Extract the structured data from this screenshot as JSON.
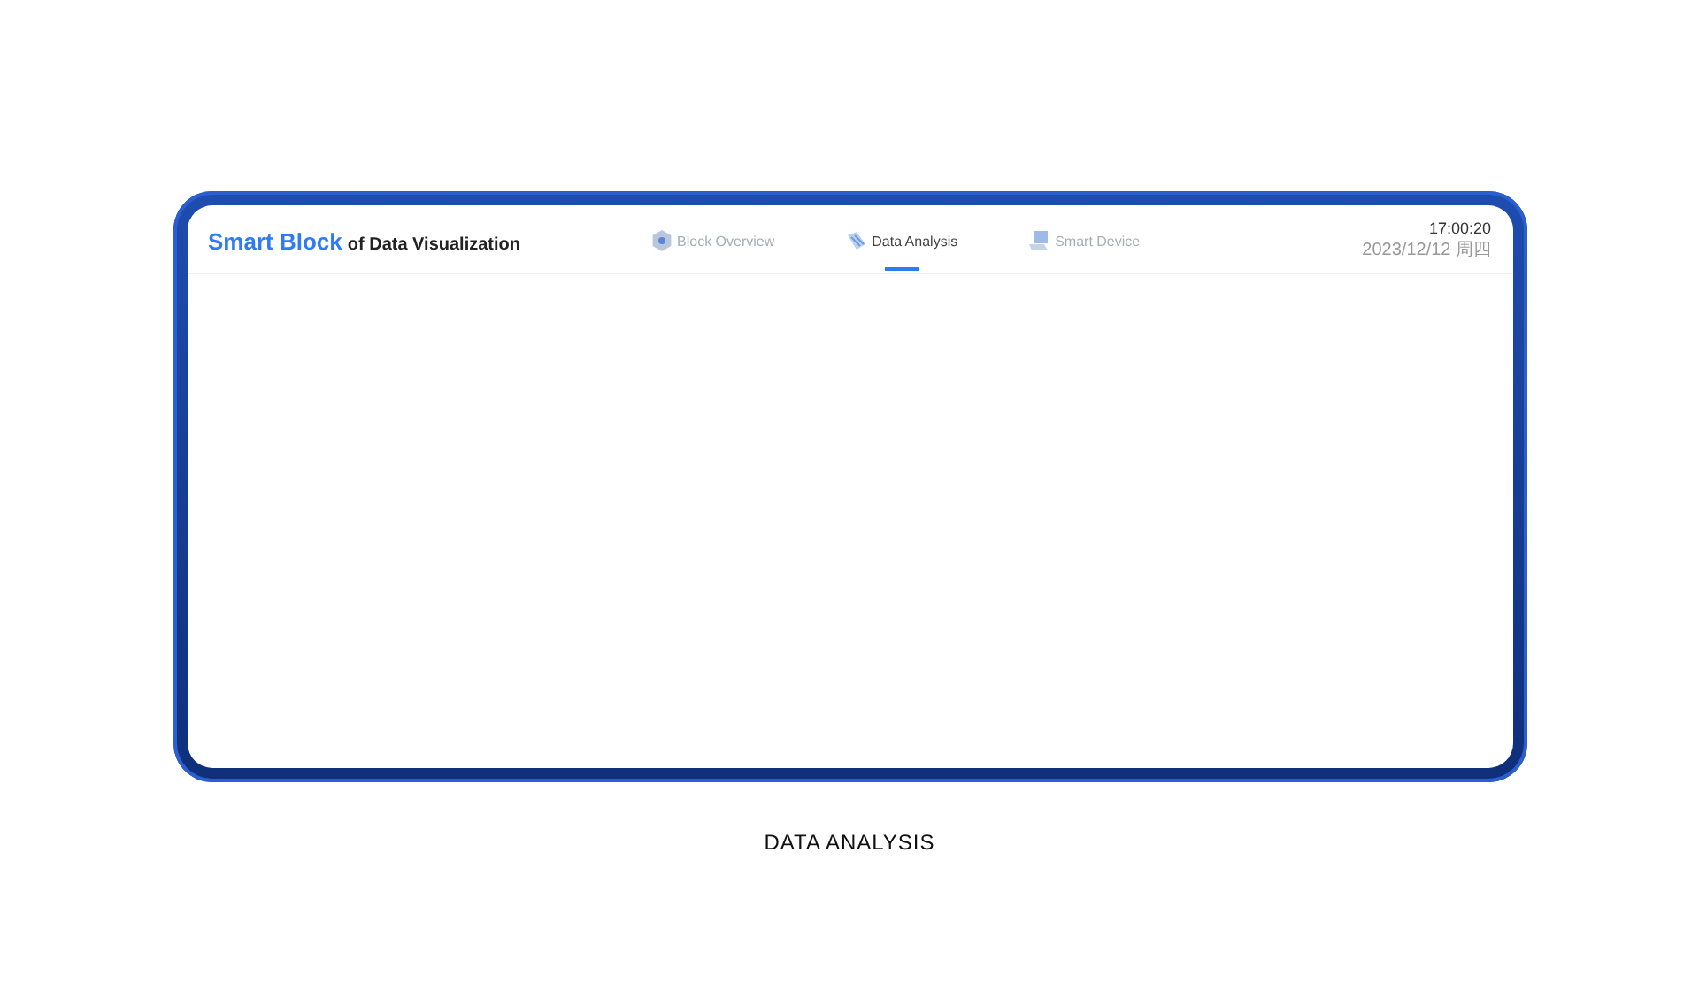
{
  "header": {
    "title_highlight": "Smart Block",
    "title_rest": "of Data Visualization"
  },
  "tabs": [
    {
      "label": "Block Overview",
      "kind": "hexagon",
      "selected": false
    },
    {
      "label": "Data Analysis",
      "kind": "stripes",
      "selected": true
    },
    {
      "label": "Smart Device",
      "kind": "laptop",
      "selected": false
    }
  ],
  "clock": {
    "time": "17:00:20",
    "date": "2023/12/12 周四"
  },
  "caption": "DATA ANALYSIS"
}
